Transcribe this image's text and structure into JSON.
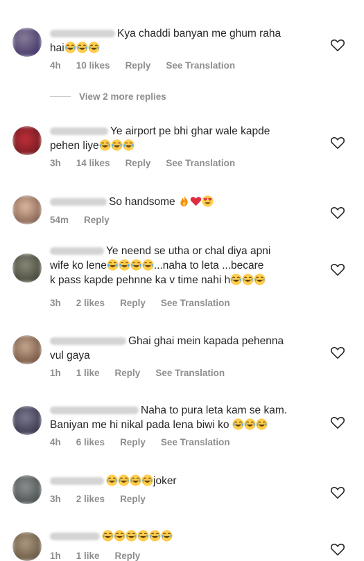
{
  "comments": [
    {
      "text_a": "Kya chaddi banyan me ghum raha",
      "text_b": "hai",
      "time": "4h",
      "likes": "10 likes",
      "reply": "Reply",
      "translate": "See Translation"
    },
    {
      "text_a": "Ye airport pe bhi ghar wale kapde",
      "text_b": "pehen liye",
      "time": "3h",
      "likes": "14 likes",
      "reply": "Reply",
      "translate": "See Translation"
    },
    {
      "text_a": "So handsome",
      "time": "54m",
      "reply": "Reply"
    },
    {
      "text_a": "Ye neend se utha or chal diya apni",
      "text_b": "wife ko lene",
      "text_b2": "...naha  to leta ...becare",
      "text_c": "k pass kapde pehnne  ka v time nahi h",
      "time": "3h",
      "likes": "2 likes",
      "reply": "Reply",
      "translate": "See Translation"
    },
    {
      "text_a": "Ghai ghai mein kapada pehenna",
      "text_b": "vul gaya",
      "time": "1h",
      "likes": "1 like",
      "reply": "Reply",
      "translate": "See Translation"
    },
    {
      "text_a": "Naha to pura leta kam se kam.",
      "text_b": "Baniyan me hi nikal pada lena biwi ko",
      "time": "4h",
      "likes": "6 likes",
      "reply": "Reply",
      "translate": "See Translation"
    },
    {
      "text_a": "joker",
      "time": "3h",
      "likes": "2 likes",
      "reply": "Reply"
    },
    {
      "time": "1h",
      "likes": "1 like",
      "reply": "Reply"
    }
  ],
  "view_replies": "View 2 more replies",
  "colors": {
    "meta": "#8e8e8e",
    "text": "#262626",
    "heart_red": "#ed4956",
    "emoji_yellow": "#ffcc4d"
  }
}
